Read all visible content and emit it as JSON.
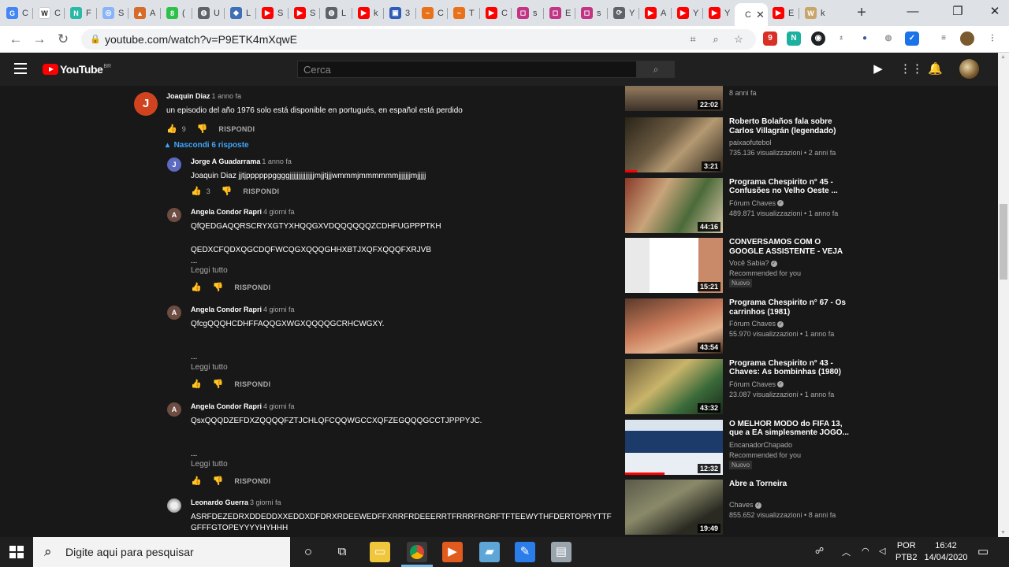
{
  "browser": {
    "tabs": [
      {
        "label": "C",
        "color": "#4285f4",
        "glyph": "G"
      },
      {
        "label": "C",
        "color": "#ffffff",
        "glyph": "W",
        "dark": true
      },
      {
        "label": "F",
        "color": "#2bb9a7",
        "glyph": "N"
      },
      {
        "label": "S",
        "color": "#8ab4f8",
        "glyph": "◎"
      },
      {
        "label": "A",
        "color": "#d76b2a",
        "glyph": "▲"
      },
      {
        "label": "(",
        "color": "#2ec14a",
        "glyph": "8"
      },
      {
        "label": "U",
        "color": "#5f6368",
        "glyph": "◍"
      },
      {
        "label": "L",
        "color": "#3f6fb5",
        "glyph": "◆"
      },
      {
        "label": "S",
        "color": "#ff0000",
        "glyph": "▶"
      },
      {
        "label": "S",
        "color": "#ff0000",
        "glyph": "▶"
      },
      {
        "label": "L",
        "color": "#5f6368",
        "glyph": "◍"
      },
      {
        "label": "k",
        "color": "#ff0000",
        "glyph": "▶"
      },
      {
        "label": "3",
        "color": "#2e5cb8",
        "glyph": "▣"
      },
      {
        "label": "C",
        "color": "#e8711a",
        "glyph": "~"
      },
      {
        "label": "T",
        "color": "#e8711a",
        "glyph": "~"
      },
      {
        "label": "C",
        "color": "#ff0000",
        "glyph": "▶"
      },
      {
        "label": "s",
        "color": "#c13584",
        "glyph": "◻"
      },
      {
        "label": "E",
        "color": "#c13584",
        "glyph": "◻"
      },
      {
        "label": "s",
        "color": "#c13584",
        "glyph": "◻"
      },
      {
        "label": "Y",
        "color": "#5f6368",
        "glyph": "⟳"
      },
      {
        "label": "A",
        "color": "#ff0000",
        "glyph": "▶"
      },
      {
        "label": "Y",
        "color": "#ff0000",
        "glyph": "▶"
      },
      {
        "label": "Y",
        "color": "#ff0000",
        "glyph": "▶"
      },
      {
        "label": "C",
        "color": "#ffffff",
        "glyph": "",
        "active": true
      },
      {
        "label": "E",
        "color": "#ff0000",
        "glyph": "▶"
      },
      {
        "label": "k",
        "color": "#c8a66a",
        "glyph": "W"
      }
    ],
    "new_tab": "+",
    "minimize": "—",
    "maximize": "❐",
    "close": "✕",
    "url": "youtube.com/watch?v=P9ETK4mXqwE",
    "extension_badge": "9"
  },
  "youtube": {
    "logo_text": "YouTube",
    "logo_country": "BR",
    "search_placeholder": "Cerca",
    "search_icon": "search-icon"
  },
  "comments": {
    "top": {
      "author": "Joaquin Diaz",
      "avatar_letter": "J",
      "avatar_color": "#d0431f",
      "time": "1 anno fa",
      "text": "un episodio del año 1976 solo está disponible en portugués, en español está perdido",
      "likes": "9",
      "reply_label": "RISPONDI"
    },
    "hide_replies": "Nascondi 6 risposte",
    "replies": [
      {
        "author": "Jorge A Guadarrama",
        "avatar_letter": "J",
        "avatar_color": "#5c6bc0",
        "time": "1 anno fa",
        "lines": [
          "Joaquin Diaz jjtjppppppggggjjjjjjjjjjjjjjmjjtjjjwmmmjmmmmmmjjjjjjjmjjjjj"
        ],
        "likes": "3",
        "reply_label": "RISPONDI"
      },
      {
        "author": "Angela Condor Rapri",
        "avatar_letter": "A",
        "avatar_color": "#6d4c41",
        "time": "4 giorni fa",
        "lines": [
          "QfQEDGAQQRSCRYXGTYXHQQGXVDQQQQQQZCDHFUGPPPTKH",
          "QEDXCFQDXQGCDQFWCQGXQQQGHHXBTJXQFXQQQFXRJVB",
          "..."
        ],
        "more": "Leggi tutto",
        "likes": "",
        "reply_label": "RISPONDI"
      },
      {
        "author": "Angela Condor Rapri",
        "avatar_letter": "A",
        "avatar_color": "#6d4c41",
        "time": "4 giorni fa",
        "lines": [
          "QfcgQQQHCDHFFAQQGXWGXQQQQGCRHCWGXY.",
          "..."
        ],
        "more": "Leggi tutto",
        "likes": "",
        "reply_label": "RISPONDI"
      },
      {
        "author": "Angela Condor Rapri",
        "avatar_letter": "A",
        "avatar_color": "#6d4c41",
        "time": "4 giorni fa",
        "lines": [
          "QsxQQQDZEFDXZQQQQFZTJCHLQFCQQWGCCXQFZEGQQQGCCTJPPPYJC.",
          "..."
        ],
        "more": "Leggi tutto",
        "likes": "",
        "reply_label": "RISPONDI"
      },
      {
        "author": "Leonardo Guerra",
        "avatar_letter": "",
        "avatar_color": "#9e9e9e",
        "time": "3 giorni fa",
        "lines": [
          "ASRFDEZEDRXDDEDDXXEDDXDFDRXRDEEWEDFFXRRFRDEEERRTFRRRFRGRFTFTEEWYTHFDERTOPRYTTF",
          "GFFFGTOPEYYYYHYHHH"
        ],
        "likes": "",
        "reply_label": "RISPONDI"
      }
    ]
  },
  "sidebar": {
    "partial_top": {
      "views": "8 anni fa",
      "duration": "22:02"
    },
    "videos": [
      {
        "title": "Roberto Bolaños fala sobre Carlos Villagrán (legendado)",
        "channel": "paixaofutebol",
        "verified": false,
        "meta": "735.136 visualizzazioni • 2 anni fa",
        "duration": "3:21",
        "progress": 0.12,
        "badge": ""
      },
      {
        "title": "Programa Chespirito n° 45 - Confusões no Velho Oeste ...",
        "channel": "Fórum Chaves",
        "verified": true,
        "meta": "489.871 visualizzazioni • 1 anno fa",
        "duration": "44:16",
        "progress": 0,
        "badge": ""
      },
      {
        "title": "CONVERSAMOS COM O GOOGLE ASSISTENTE - VEJA ...",
        "channel": "Você Sabia?",
        "verified": true,
        "meta": "Recommended for you",
        "duration": "15:21",
        "progress": 0,
        "badge": "Nuovo"
      },
      {
        "title": "Programa Chespirito n° 67 - Os carrinhos (1981)",
        "channel": "Fórum Chaves",
        "verified": true,
        "meta": "55.970 visualizzazioni • 1 anno fa",
        "duration": "43:54",
        "progress": 0,
        "badge": ""
      },
      {
        "title": "Programa Chespirito n° 43 - Chaves: As bombinhas (1980)",
        "channel": "Fórum Chaves",
        "verified": true,
        "meta": "23.087 visualizzazioni • 1 anno fa",
        "duration": "43:32",
        "progress": 0,
        "badge": ""
      },
      {
        "title": "O MELHOR MODO do FIFA 13, que a EA simplesmente JOGO...",
        "channel": "EncanadorChapado",
        "verified": false,
        "meta": "Recommended for you",
        "duration": "12:32",
        "progress": 0.4,
        "badge": "Nuovo"
      },
      {
        "title": "Abre a Torneira",
        "channel": "Chaves",
        "verified": true,
        "meta": "855.652 visualizzazioni • 8 anni fa",
        "duration": "19:49",
        "progress": 0,
        "badge": ""
      }
    ]
  },
  "taskbar": {
    "search_placeholder": "Digite aqui para pesquisar",
    "lang_top": "POR",
    "lang_bottom": "PTB2",
    "time": "16:42",
    "date": "14/04/2020"
  }
}
